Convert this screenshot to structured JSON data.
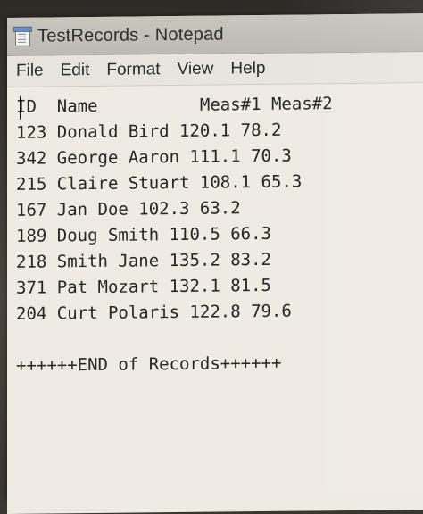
{
  "window": {
    "title": "TestRecords - Notepad",
    "app_icon": "notepad-icon"
  },
  "menu": {
    "items": [
      {
        "label": "File"
      },
      {
        "label": "Edit"
      },
      {
        "label": "Format"
      },
      {
        "label": "View"
      },
      {
        "label": "Help"
      }
    ]
  },
  "document": {
    "header": "ID  Name          Meas#1 Meas#2",
    "records": [
      "123 Donald Bird 120.1 78.2",
      "342 George Aaron 111.1 70.3",
      "215 Claire Stuart 108.1 65.3",
      "167 Jan Doe 102.3 63.2",
      "189 Doug Smith 110.5 66.3",
      "218 Smith Jane 135.2 83.2",
      "371 Pat Mozart 132.1 81.5",
      "204 Curt Polaris 122.8 79.6"
    ],
    "footer": "++++++END of Records++++++"
  }
}
